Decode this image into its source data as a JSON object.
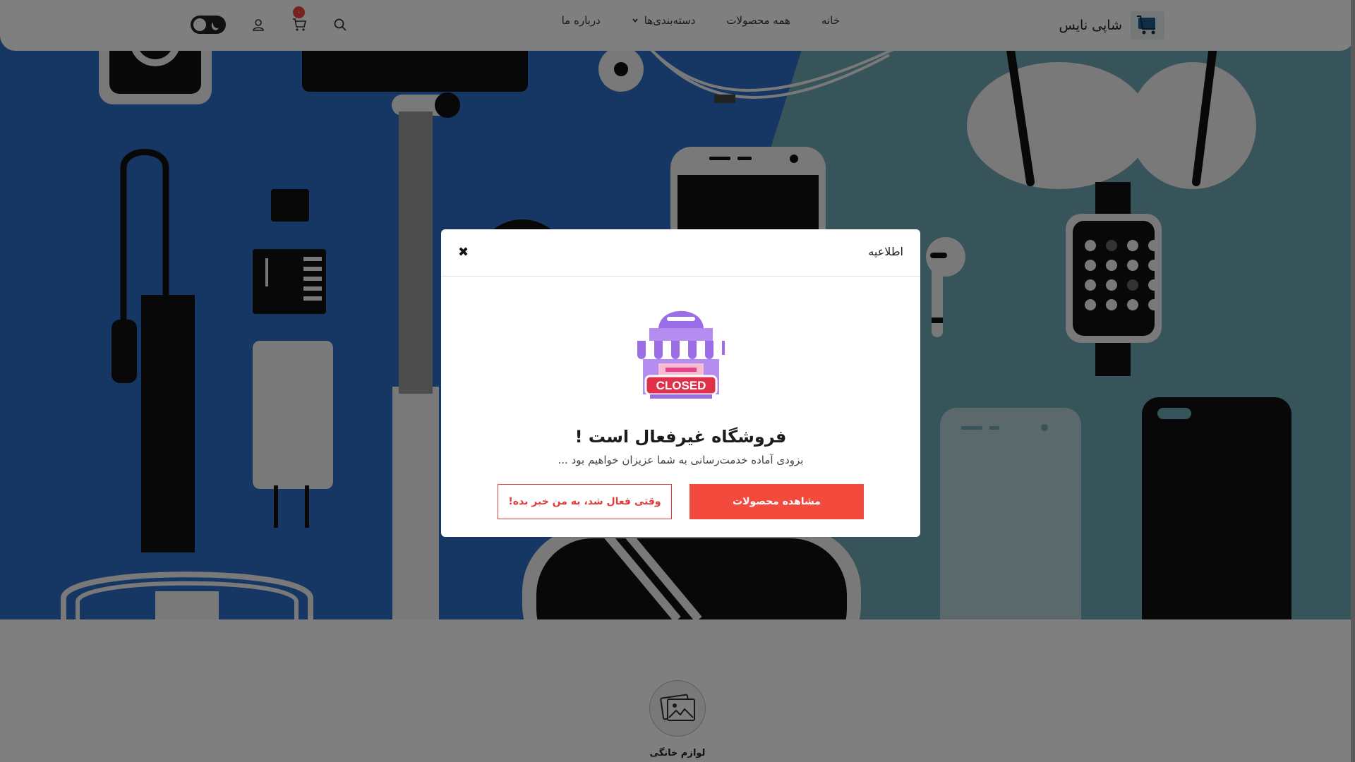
{
  "header": {
    "brand_name": "شاپی نایس",
    "nav": {
      "home": "خانه",
      "all_products": "همه محصولات",
      "categories": "دسته‌بندی‌ها",
      "about": "درباره ما"
    },
    "cart_count": "۰"
  },
  "modal": {
    "title": "اطلاعیه",
    "heading": "فروشگاه غیرفعال است !",
    "subtitle": "بزودی آماده خدمت‌رسانی به شما عزیزان خواهیم بود ...",
    "closed_sign": "CLOSED",
    "primary_button": "مشاهده محصولات",
    "secondary_button": "وقتی فعال شد، به من خبر بده!"
  },
  "category": {
    "label": "لوازم خانگی"
  },
  "colors": {
    "accent": "#f24a3d",
    "hero_blue": "#2c6cc9",
    "hero_teal": "#6fa9b4"
  }
}
